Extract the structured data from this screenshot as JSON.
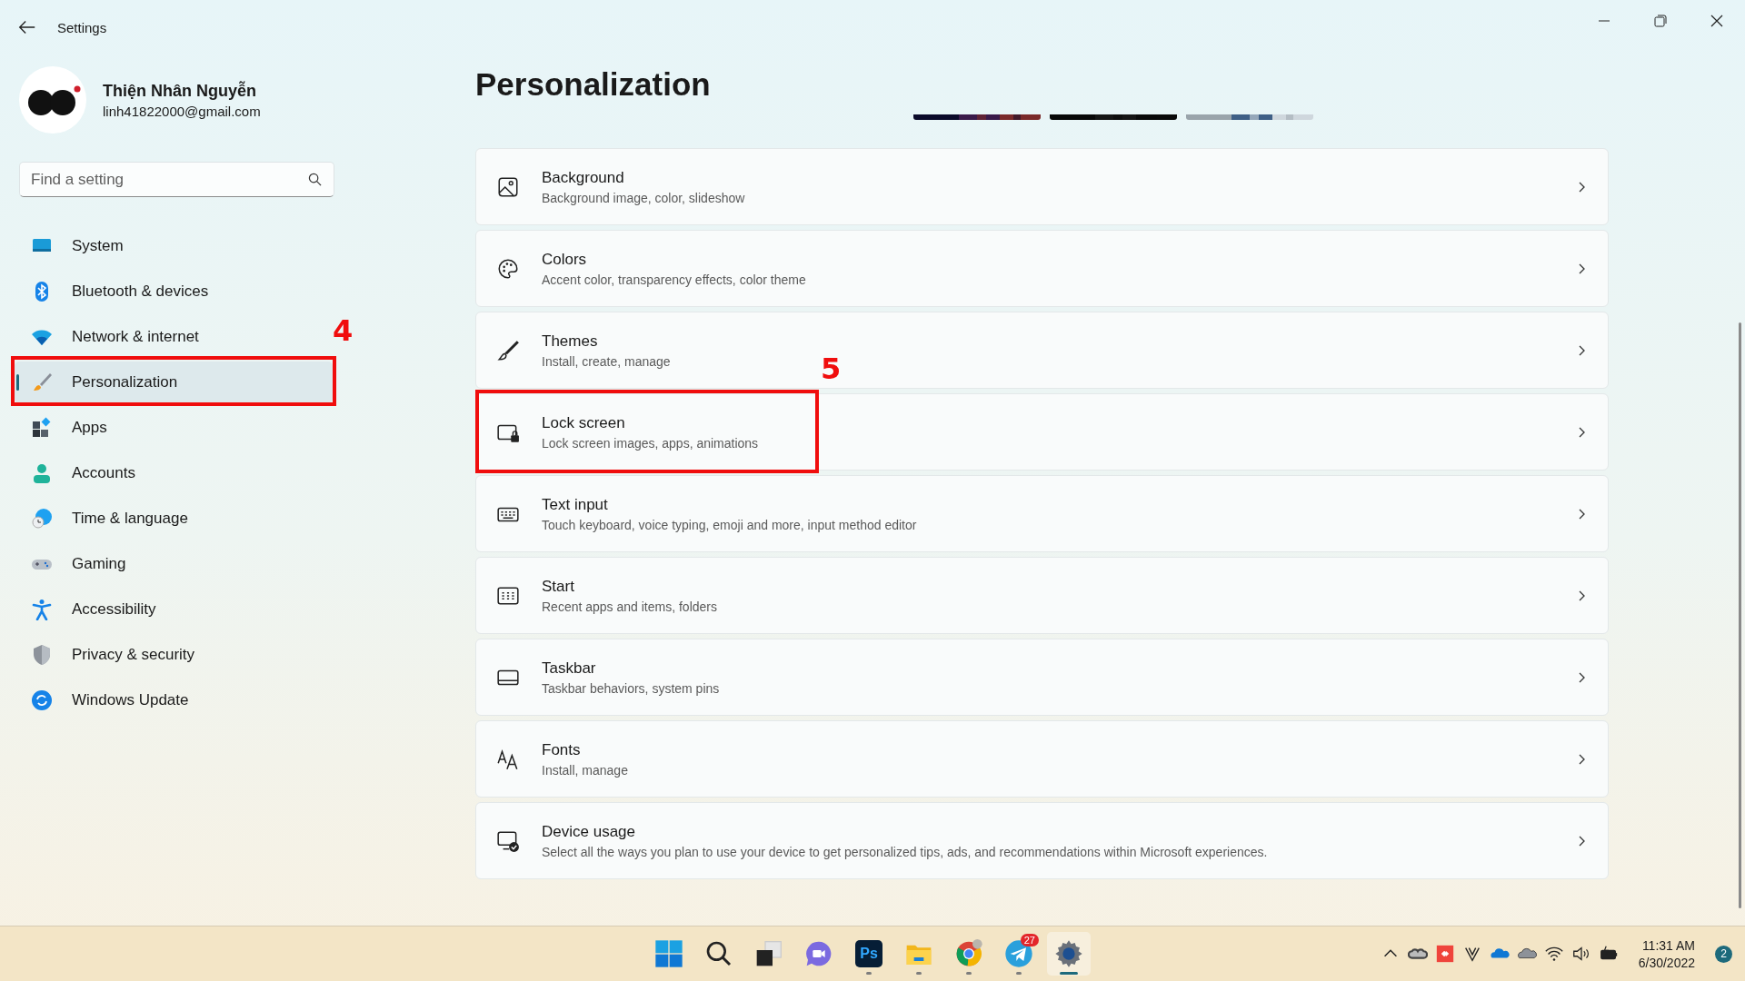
{
  "window": {
    "title": "Settings"
  },
  "profile": {
    "name": "Thiện Nhân Nguyễn",
    "email": "linh41822000@gmail.com"
  },
  "search": {
    "placeholder": "Find a setting"
  },
  "sidebar": {
    "items": [
      {
        "label": "System",
        "kind": "system",
        "selected": false
      },
      {
        "label": "Bluetooth & devices",
        "kind": "bluetooth",
        "selected": false
      },
      {
        "label": "Network & internet",
        "kind": "network",
        "selected": false
      },
      {
        "label": "Personalization",
        "kind": "brush",
        "selected": true
      },
      {
        "label": "Apps",
        "kind": "apps",
        "selected": false
      },
      {
        "label": "Accounts",
        "kind": "accounts",
        "selected": false
      },
      {
        "label": "Time & language",
        "kind": "time",
        "selected": false
      },
      {
        "label": "Gaming",
        "kind": "gaming",
        "selected": false
      },
      {
        "label": "Accessibility",
        "kind": "accessibility",
        "selected": false
      },
      {
        "label": "Privacy & security",
        "kind": "privacy",
        "selected": false
      },
      {
        "label": "Windows Update",
        "kind": "update",
        "selected": false
      }
    ]
  },
  "page": {
    "title": "Personalization"
  },
  "settings": [
    {
      "kind": "background",
      "title": "Background",
      "subtitle": "Background image, color, slideshow"
    },
    {
      "kind": "colors",
      "title": "Colors",
      "subtitle": "Accent color, transparency effects, color theme"
    },
    {
      "kind": "themes",
      "title": "Themes",
      "subtitle": "Install, create, manage"
    },
    {
      "kind": "lock",
      "title": "Lock screen",
      "subtitle": "Lock screen images, apps, animations"
    },
    {
      "kind": "keyboard",
      "title": "Text input",
      "subtitle": "Touch keyboard, voice typing, emoji and more, input method editor"
    },
    {
      "kind": "start",
      "title": "Start",
      "subtitle": "Recent apps and items, folders"
    },
    {
      "kind": "taskbar",
      "title": "Taskbar",
      "subtitle": "Taskbar behaviors, system pins"
    },
    {
      "kind": "fonts",
      "title": "Fonts",
      "subtitle": "Install, manage"
    },
    {
      "kind": "device",
      "title": "Device usage",
      "subtitle": "Select all the ways you plan to use your device to get personalized tips, ads, and recommendations within Microsoft experiences."
    }
  ],
  "annotations": [
    {
      "kind": "nav",
      "label": "4"
    },
    {
      "kind": "card",
      "label": "5"
    }
  ],
  "taskbar": {
    "apps": [
      {
        "kind": "start",
        "running": false,
        "active": false
      },
      {
        "kind": "search",
        "running": false,
        "active": false
      },
      {
        "kind": "taskview",
        "running": false,
        "active": false
      },
      {
        "kind": "meet",
        "running": false,
        "active": false
      },
      {
        "kind": "photoshop",
        "label": "Ps",
        "running": true,
        "active": false
      },
      {
        "kind": "explorer",
        "running": true,
        "active": false
      },
      {
        "kind": "chrome",
        "running": true,
        "active": false
      },
      {
        "kind": "telegram",
        "badge": "27",
        "running": true,
        "active": false
      },
      {
        "kind": "settings",
        "running": true,
        "active": true
      }
    ],
    "tray": [
      {
        "kind": "chevron"
      },
      {
        "kind": "creative-cloud"
      },
      {
        "kind": "anydesk"
      },
      {
        "kind": "v"
      },
      {
        "kind": "onedrive"
      },
      {
        "kind": "cloud"
      },
      {
        "kind": "wifi"
      },
      {
        "kind": "volume"
      },
      {
        "kind": "battery"
      }
    ],
    "time": "11:31 AM",
    "date": "6/30/2022",
    "notifications": "2"
  }
}
